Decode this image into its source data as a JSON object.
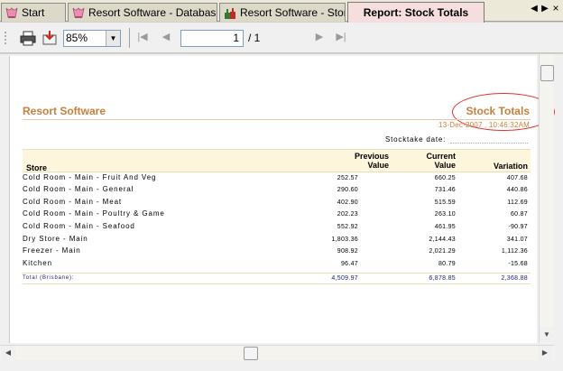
{
  "tabs": [
    {
      "label": "Start"
    },
    {
      "label": "Resort Software - Database"
    },
    {
      "label": "Resort Software - Stores"
    },
    {
      "label": "Report: Stock Totals"
    }
  ],
  "toolbar": {
    "zoom": "85%",
    "page_current": "1",
    "page_total": "/ 1"
  },
  "report": {
    "company": "Resort Software",
    "title": "Stock Totals",
    "datetime": "13-Dec-2007 , 10:46:32AM",
    "stocktake_label": "Stocktake date:",
    "headers": {
      "store": "Store",
      "previous_line1": "Previous",
      "previous_line2": "Value",
      "current_line1": "Current",
      "current_line2": "Value",
      "variation": "Variation"
    },
    "rows": [
      {
        "store": "Cold Room - Main - Fruit And Veg",
        "previous": "252.57",
        "current": "660.25",
        "variation": "407.68"
      },
      {
        "store": "Cold Room - Main - General",
        "previous": "290.60",
        "current": "731.46",
        "variation": "440.86"
      },
      {
        "store": "Cold Room - Main - Meat",
        "previous": "402.90",
        "current": "515.59",
        "variation": "112.69"
      },
      {
        "store": "Cold Room - Main - Poultry & Game",
        "previous": "202.23",
        "current": "263.10",
        "variation": "60.87"
      },
      {
        "store": "Cold Room - Main - Seafood",
        "previous": "552.92",
        "current": "461.95",
        "variation": "-90.97"
      },
      {
        "store": "Dry Store - Main",
        "previous": "1,803.36",
        "current": "2,144.43",
        "variation": "341.07"
      },
      {
        "store": "Freezer - Main",
        "previous": "908.92",
        "current": "2,021.29",
        "variation": "1,112.36"
      },
      {
        "store": "Kitchen",
        "previous": "96.47",
        "current": "80.79",
        "variation": "-15.68"
      }
    ],
    "total": {
      "label": "Total (Brisbane):",
      "previous": "4,509.97",
      "current": "6,878.85",
      "variation": "2,368.88"
    }
  },
  "colors": {
    "accent": "#c77f3b",
    "header_bg": "#fdf6dc",
    "totals_text": "#1a237e",
    "highlight_oval": "#e03030"
  }
}
